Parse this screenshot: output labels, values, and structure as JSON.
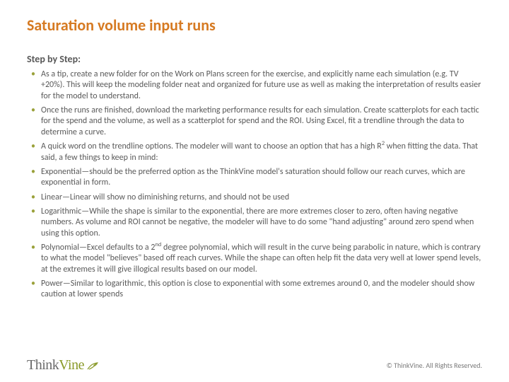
{
  "title": "Saturation volume input runs",
  "subhead": "Step by Step:",
  "bullets": [
    "As a tip, create a new folder for on the Work on Plans screen for the exercise, and explicitly name each simulation (e.g. TV +20%).  This will keep the modeling folder neat and organized for future use as well as making the interpretation of results easier for the model to understand.",
    "Once the runs are finished, download the marketing performance results for each simulation.  Create scatterplots for each tactic for the spend and the volume, as well as a scatterplot for spend and the ROI.  Using Excel, fit a trendline through the data to determine a curve.",
    "A quick word on the trendline options.  The modeler will want to choose an option that has a high R<sup>2</sup> when fitting the data.  That said, a few things to keep in mind:",
    "Exponential—should be the preferred option as the ThinkVine model's saturation should follow our reach curves, which are exponential in form.",
    "Linear—Linear will show no diminishing returns, and should not be used",
    "Logarithmic—While the shape is similar to the exponential, there are more extremes closer to zero, often having negative numbers.  As volume and ROI cannot be negative, the modeler will have to do some \"hand adjusting\" around zero spend when using this option.",
    "Polynomial—Excel defaults to a 2<sup>nd</sup> degree polynomial, which will result in the curve being parabolic in nature, which is contrary to what the model \"believes\" based off reach curves.  While the shape can often help fit the data very well at lower spend levels, at the extremes it will give illogical results based on our model.",
    "Power—Similar to logarithmic, this option is close to exponential with some extremes around 0, and the modeler should show caution at lower spends"
  ],
  "logo": {
    "think": "Think",
    "vine": "Vine"
  },
  "copyright": "© ThinkVine.  All Rights Reserved."
}
